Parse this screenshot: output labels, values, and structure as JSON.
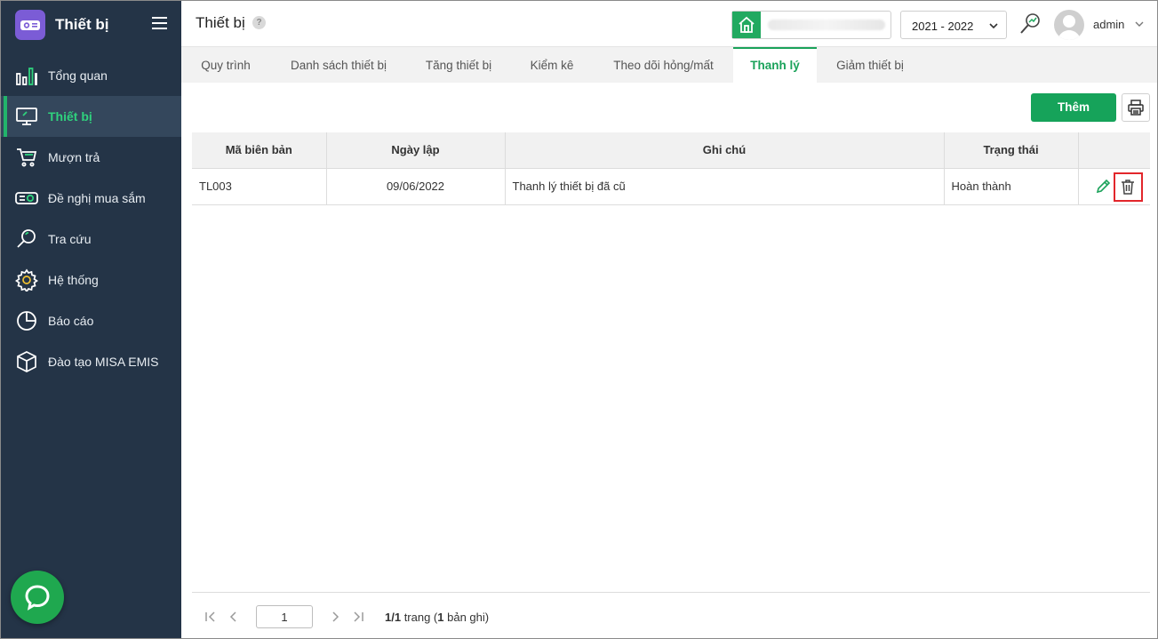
{
  "app": {
    "title": "Thiết bị",
    "menu": [
      {
        "label": "Tổng quan",
        "icon": "bar-chart-icon"
      },
      {
        "label": "Thiết bị",
        "icon": "monitor-icon",
        "active": true
      },
      {
        "label": "Mượn trả",
        "icon": "cart-icon"
      },
      {
        "label": "Đề nghị mua sắm",
        "icon": "projector-icon"
      },
      {
        "label": "Tra cứu",
        "icon": "search-icon"
      },
      {
        "label": "Hệ thống",
        "icon": "gear-icon"
      },
      {
        "label": "Báo cáo",
        "icon": "pie-chart-icon"
      },
      {
        "label": "Đào tạo MISA EMIS",
        "icon": "box-icon"
      }
    ]
  },
  "header": {
    "title": "Thiết bị",
    "help": "?",
    "year": "2021 - 2022",
    "user": "admin"
  },
  "tabs": [
    {
      "label": "Quy trình"
    },
    {
      "label": "Danh sách thiết bị"
    },
    {
      "label": "Tăng thiết bị"
    },
    {
      "label": "Kiểm kê"
    },
    {
      "label": "Theo dõi hỏng/mất"
    },
    {
      "label": "Thanh lý",
      "active": true
    },
    {
      "label": "Giảm thiết bị"
    }
  ],
  "toolbar": {
    "add_label": "Thêm"
  },
  "table": {
    "columns": [
      "Mã biên bản",
      "Ngày lập",
      "Ghi chú",
      "Trạng thái"
    ],
    "rows": [
      {
        "code": "TL003",
        "date": "09/06/2022",
        "note": "Thanh lý thiết bị đã cũ",
        "status": "Hoàn thành"
      }
    ]
  },
  "pager": {
    "page": "1",
    "info_current": "1/1",
    "info_trang": " trang (",
    "info_count": "1",
    "info_records": " bản ghi)"
  },
  "colors": {
    "sidebar": "#243447",
    "accent": "#16a35a",
    "highlight": "#e2262b"
  }
}
